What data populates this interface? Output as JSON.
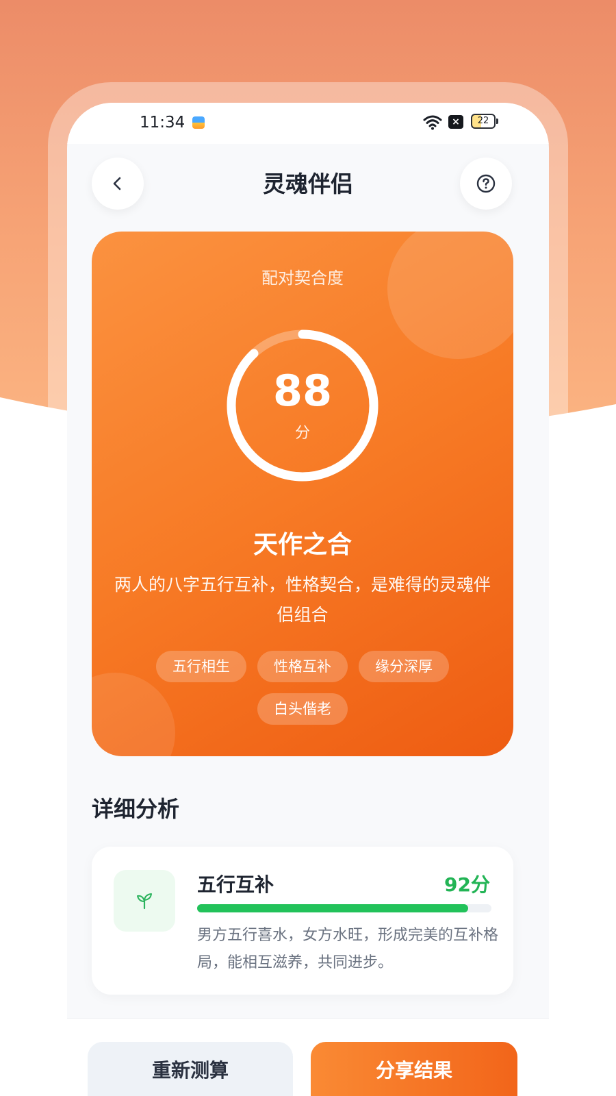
{
  "status_bar": {
    "time": "11:34",
    "battery": "22"
  },
  "header": {
    "title": "灵魂伴侣",
    "back_icon": "chevron-left-icon",
    "help_icon": "question-circle-icon"
  },
  "score_card": {
    "label": "配对契合度",
    "score": "88",
    "score_unit": "分",
    "score_fraction": 0.88,
    "result_title": "天作之合",
    "description": "两人的八字五行互补，性格契合，是难得的灵魂伴侣组合",
    "tags": [
      "五行相生",
      "性格互补",
      "缘分深厚",
      "白头偕老"
    ],
    "accent_color": "#f77a25"
  },
  "analysis": {
    "section_title": "详细分析",
    "items": [
      {
        "icon": "sprout-icon",
        "title": "五行互补",
        "score": "92分",
        "progress": 0.92,
        "description": "男方五行喜水，女方水旺，形成完美的互补格局，能相互滋养，共同进步。",
        "color": "#22c25a"
      }
    ]
  },
  "actions": {
    "retry_label": "重新测算",
    "share_label": "分享结果"
  }
}
